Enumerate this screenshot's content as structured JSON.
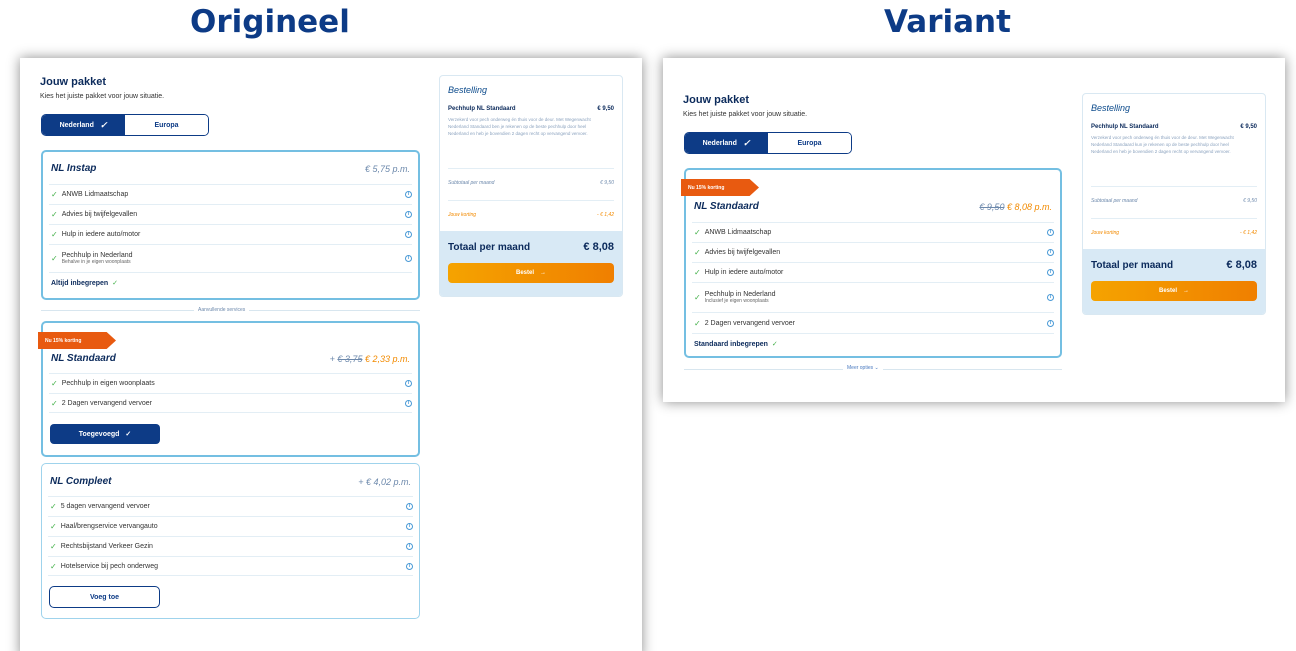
{
  "headings": {
    "original": "Origineel",
    "variant": "Variant"
  },
  "original": {
    "package_title": "Jouw pakket",
    "package_subtitle": "Kies het juiste pakket voor jouw situatie.",
    "toggle": {
      "active": "Nederland",
      "inactive": "Europa"
    },
    "card_instap": {
      "name": "NL Instap",
      "price": "€ 5,75 p.m.",
      "features": [
        {
          "label": "ANWB Lidmaatschap"
        },
        {
          "label": "Advies bij twijfelgevallen"
        },
        {
          "label": "Hulp in iedere auto/motor"
        },
        {
          "label": "Pechhulp in Nederland",
          "sub": "Behalve in je eigen woonplaats"
        }
      ],
      "included": "Altijd inbegrepen"
    },
    "extra_services_label": "Aanvullende services",
    "card_standaard": {
      "ribbon": "Nu 15% korting",
      "name": "NL Standaard",
      "price_prefix": "+",
      "price_old": "€ 3,75",
      "price_new": "€ 2,33 p.m.",
      "features": [
        {
          "label": "Pechhulp in eigen woonplaats"
        },
        {
          "label": "2 Dagen vervangend vervoer"
        }
      ],
      "button": "Toegevoegd"
    },
    "card_compleet": {
      "name": "NL Compleet",
      "price": "+ € 4,02 p.m.",
      "features": [
        {
          "label": "5 dagen vervangend vervoer"
        },
        {
          "label": "Haal/brengservice vervangauto"
        },
        {
          "label": "Rechtsbijstand Verkeer Gezin"
        },
        {
          "label": "Hotelservice bij pech onderweg"
        }
      ],
      "button": "Voeg toe"
    },
    "order": {
      "title": "Bestelling",
      "item_name": "Pechhulp NL Standaard",
      "item_price": "€ 9,50",
      "item_desc": "Verzekerd voor pech onderweg én thuis voor de deur. Met Wegenwacht Nederland Standaard ben je rekenen op de beste pechhulp door heel Nederland en heb je bovendien 2 dagen recht op vervangend vervoer.",
      "subtotal_label": "Subtotaal per maand",
      "subtotal_value": "€ 9,50",
      "discount_label": "Jouw korting",
      "discount_value": "- € 1,42",
      "total_label": "Totaal per maand",
      "total_value": "€ 8,08",
      "button": "Bestel"
    }
  },
  "variant": {
    "package_title": "Jouw pakket",
    "package_subtitle": "Kies het juiste pakket voor jouw situatie.",
    "toggle": {
      "active": "Nederland",
      "inactive": "Europa"
    },
    "card": {
      "ribbon": "Nu 15% korting",
      "name": "NL Standaard",
      "price_old": "€ 9,50",
      "price_new": "€ 8,08 p.m.",
      "features": [
        {
          "label": "ANWB Lidmaatschap"
        },
        {
          "label": "Advies bij twijfelgevallen"
        },
        {
          "label": "Hulp in iedere auto/motor"
        },
        {
          "label": "Pechhulp in Nederland",
          "sub": "Inclusief je eigen woonplaats"
        },
        {
          "label": "2 Dagen vervangend vervoer"
        }
      ],
      "included": "Standaard inbegrepen"
    },
    "more_options": "Meer opties",
    "order": {
      "title": "Bestelling",
      "item_name": "Pechhulp NL Standaard",
      "item_price": "€ 9,50",
      "item_desc": "Verzekerd voor pech onderweg én thuis voor de deur. Met Wegenwacht Nederland Standaard kun je rekenen op de beste pechhulp door heel Nederland en heb je bovendien 2 dagen recht op vervangend vervoer.",
      "subtotal_label": "Subtotaal per maand",
      "subtotal_value": "€ 9,50",
      "discount_label": "Jouw korting",
      "discount_value": "- € 1,42",
      "total_label": "Totaal per maand",
      "total_value": "€ 8,08",
      "button": "Bestel"
    }
  }
}
